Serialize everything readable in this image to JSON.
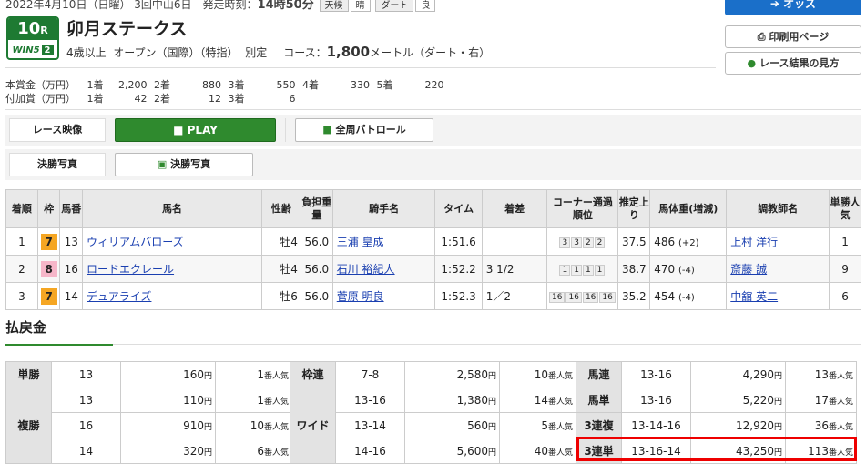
{
  "header": {
    "date_line": "2022年4月10日（日曜） 3回中山6日　発走時刻：",
    "post_time": "14時50分",
    "weather_label": "天候",
    "weather": "晴",
    "track_label": "ダート",
    "track_cond": "良",
    "race_number": "10",
    "race_suffix": "R",
    "win5_label": "WIN5",
    "win5_leg": "2",
    "race_name": "卯月ステークス",
    "cond_age": "4歳以上",
    "cond_class": "オープン（国際）（特指）",
    "cond_weight": "別定",
    "course_label": "コース：",
    "course_dist": "1,800",
    "course_unit": "メートル（ダート・右）"
  },
  "side_buttons": {
    "odds": "オッズ",
    "print": "印刷用ページ",
    "guide": "レース結果の見方"
  },
  "prize": {
    "main_label": "本賞金（万円）",
    "main": [
      [
        "1着",
        "2,200"
      ],
      [
        "2着",
        "880"
      ],
      [
        "3着",
        "550"
      ],
      [
        "4着",
        "330"
      ],
      [
        "5着",
        "220"
      ]
    ],
    "add_label": "付加賞（万円）",
    "add": [
      [
        "1着",
        "42"
      ],
      [
        "2着",
        "12"
      ],
      [
        "3着",
        "6"
      ]
    ]
  },
  "media": {
    "video_label": "レース映像",
    "play": "PLAY",
    "patrol": "全周パトロール",
    "photo_label": "決勝写真",
    "photo_btn": "決勝写真"
  },
  "results": {
    "headers": [
      "着順",
      "枠",
      "馬番",
      "馬名",
      "性齢",
      "負担重量",
      "騎手名",
      "タイム",
      "着差",
      "コーナー通過順位",
      "推定上り",
      "馬体重(増減)",
      "調教師名",
      "単勝人気"
    ],
    "rows": [
      {
        "rank": "1",
        "waku": "7",
        "num": "13",
        "horse": "ウィリアムバローズ",
        "sexage": "牡4",
        "weight": "56.0",
        "jockey": "三浦 皇成",
        "time": "1:51.6",
        "margin": "",
        "corner": [
          "3",
          "3",
          "2",
          "2"
        ],
        "agari": "37.5",
        "body": "486",
        "diff": "(+2)",
        "trainer": "上村 洋行",
        "pop": "1"
      },
      {
        "rank": "2",
        "waku": "8",
        "num": "16",
        "horse": "ロードエクレール",
        "sexage": "牡4",
        "weight": "56.0",
        "jockey": "石川 裕紀人",
        "time": "1:52.2",
        "margin": "3 1/2",
        "corner": [
          "1",
          "1",
          "1",
          "1"
        ],
        "agari": "38.7",
        "body": "470",
        "diff": "(-4)",
        "trainer": "斎藤 誠",
        "pop": "9"
      },
      {
        "rank": "3",
        "waku": "7",
        "num": "14",
        "horse": "デュアライズ",
        "sexage": "牡6",
        "weight": "56.0",
        "jockey": "菅原 明良",
        "time": "1:52.3",
        "margin": "1／2",
        "corner": [
          "16",
          "16",
          "16",
          "16"
        ],
        "agari": "35.2",
        "body": "454",
        "diff": "(-4)",
        "trainer": "中舘 英二",
        "pop": "6"
      }
    ]
  },
  "payout": {
    "title": "払戻金",
    "yen": "円",
    "pop_suffix": "番人気",
    "tansho": {
      "label": "単勝",
      "combo": "13",
      "amount": "160",
      "pop": "1"
    },
    "fukusho": {
      "label": "複勝",
      "rows": [
        {
          "combo": "13",
          "amount": "110",
          "pop": "1"
        },
        {
          "combo": "16",
          "amount": "910",
          "pop": "10"
        },
        {
          "combo": "14",
          "amount": "320",
          "pop": "6"
        }
      ]
    },
    "wakuren": {
      "label": "枠連",
      "combo": "7-8",
      "amount": "2,580",
      "pop": "10"
    },
    "wide": {
      "label": "ワイド",
      "rows": [
        {
          "combo": "13-16",
          "amount": "1,380",
          "pop": "14"
        },
        {
          "combo": "13-14",
          "amount": "560",
          "pop": "5"
        },
        {
          "combo": "14-16",
          "amount": "5,600",
          "pop": "40"
        }
      ]
    },
    "umaren": {
      "label": "馬連",
      "combo": "13-16",
      "amount": "4,290",
      "pop": "13"
    },
    "umatan": {
      "label": "馬単",
      "combo": "13-16",
      "amount": "5,220",
      "pop": "17"
    },
    "sanrenpuku": {
      "label": "3連複",
      "combo": "13-14-16",
      "amount": "12,920",
      "pop": "36"
    },
    "sanrentan": {
      "label": "3連単",
      "combo": "13-16-14",
      "amount": "43,250",
      "pop": "113"
    }
  }
}
